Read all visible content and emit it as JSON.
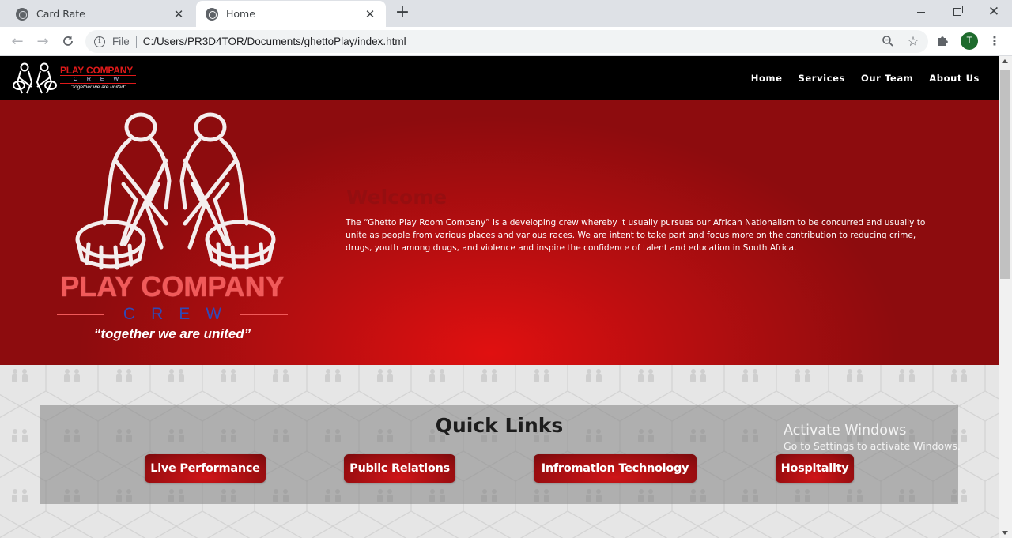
{
  "browser": {
    "tabs": [
      {
        "title": "Card Rate",
        "active": false
      },
      {
        "title": "Home",
        "active": true
      }
    ],
    "scheme_label": "File",
    "url": "C:/Users/PR3D4TOR/Documents/ghettoPlay/index.html",
    "profile_initial": "T",
    "profile_color": "#1e6b2d"
  },
  "site": {
    "brand": {
      "name": "PLAY COMPANY",
      "crew": "C R E W",
      "slogan": "\"together we are united\""
    },
    "nav": [
      "Home",
      "Services",
      "Our Team",
      "About Us"
    ],
    "hero": {
      "logo_name": "PLAY COMPANY",
      "logo_crew": "CREW",
      "logo_slogan": "“together we are united”",
      "welcome_title": "Welcome",
      "welcome_text": "The “Ghetto Play Room Company” is a developing crew whereby it usually pursues our African Nationalism to be concurred and usually to unite as people from various places and various races. We are intent to take part and focus more on the contribution to reducing crime, drugs, youth among drugs, and violence and inspire the confidence of talent and education in South Africa."
    },
    "quick_links": {
      "title": "Quick Links",
      "items": [
        "Live Performance",
        "Public Relations",
        "Infromation Technology",
        "Hospitality"
      ]
    },
    "colors": {
      "accent_red": "#c8101a",
      "nav_bg": "#000000",
      "crew_blue": "#2f4ab8"
    }
  },
  "os_overlay": {
    "title": "Activate Windows",
    "subtitle": "Go to Settings to activate Windows."
  }
}
